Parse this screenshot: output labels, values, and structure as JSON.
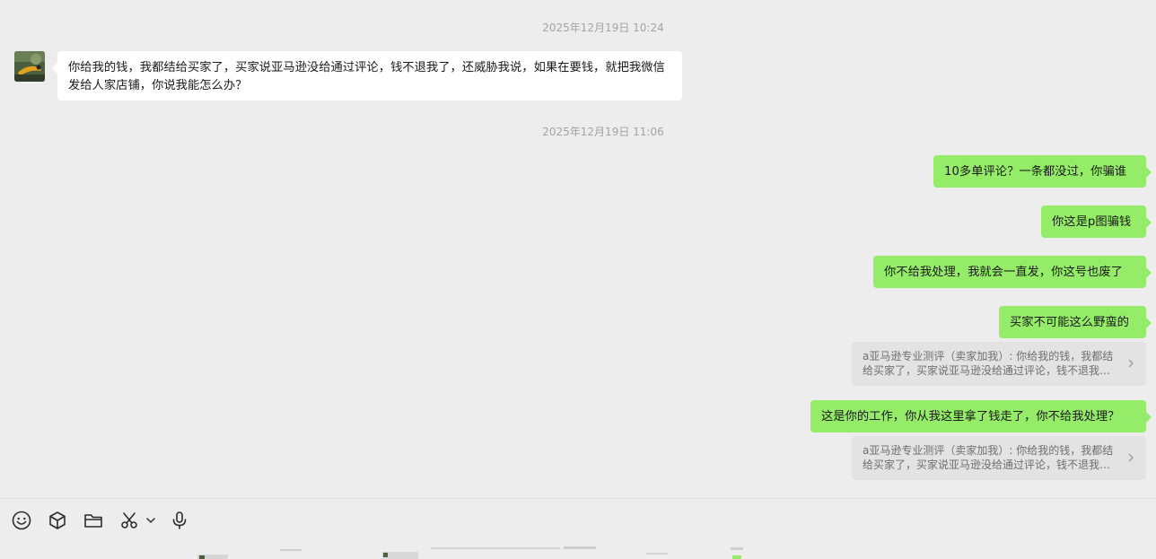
{
  "messages": {
    "ts1": "2025年12月19日 10:24",
    "incoming1": "你给我的钱，我都结给买家了，买家说亚马逊没给通过评论，钱不退我了，还威胁我说，如果在要钱，就把我微信发给人家店铺，你说我能怎么办？",
    "ts2": "2025年12月19日 11:06",
    "out1": "10多单评论？一条都没过，你骗谁",
    "out2": "你这是p图骗钱",
    "out3": "你不给我处理，我就会一直发，你这号也废了",
    "out4": "买家不可能这么野蛮的",
    "quote1": "a亚马逊专业测评（卖家加我）: 你给我的钱，我都结给买家了，买家说亚马逊没给通过评论，钱不退我了，还威胁我说，如果在要钱，就把我微信发给人家店铺，你说我能怎么办？",
    "out5": "这是你的工作，你从我这里拿了钱走了，你不给我处理？",
    "quote2": "a亚马逊专业测评（卖家加我）: 你给我的钱，我都结给买家了，买家说亚马逊没给通过评论，钱不退我了，还威胁我说，如果在要钱，就把我微信发给人家店铺，你说我能怎么办？"
  },
  "toolbar": {
    "icons": [
      "emoji-icon",
      "cube-icon",
      "folder-icon",
      "scissors-icon",
      "chevron-down-icon",
      "microphone-icon"
    ]
  },
  "colors": {
    "background": "#ededed",
    "outgoing_bubble": "#95ec69",
    "incoming_bubble": "#ffffff",
    "quote_bg": "#e3e3e3"
  }
}
